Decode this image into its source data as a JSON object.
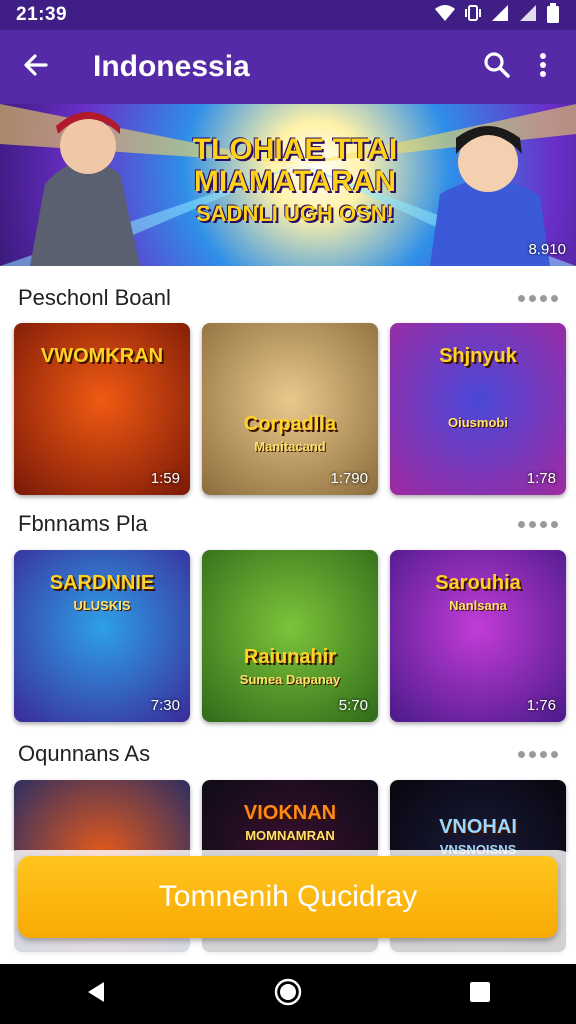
{
  "status_bar": {
    "time": "21:39"
  },
  "app_bar": {
    "title": "Indonessia"
  },
  "banner": {
    "line1": "TLOHIAE TTAI",
    "line2": "MIAMATARAN",
    "line3": "SADNLI UGH OSN!",
    "count": "8.910"
  },
  "sections": [
    {
      "title": "Peschonl Boanl",
      "cards": [
        {
          "title": "VWOMKRAN",
          "subtitle": "",
          "count": "1:59",
          "colors": [
            "#f05a12",
            "#7a1808"
          ]
        },
        {
          "title": "Corpadlla",
          "subtitle": "Manitacand",
          "count": "1:790",
          "colors": [
            "#e9c98c",
            "#8b6c3c"
          ]
        },
        {
          "title": "Shjnyuk",
          "subtitle": "Oiusmobi",
          "count": "1:78",
          "colors": [
            "#4a48d8",
            "#a02aa0"
          ]
        }
      ]
    },
    {
      "title": "Fbnnams Pla",
      "cards": [
        {
          "title": "SARDNNIE",
          "subtitle": "ULUSKIS",
          "count": "7:30",
          "colors": [
            "#2ea0e8",
            "#3a2a9a"
          ]
        },
        {
          "title": "Raiunahir",
          "subtitle": "Sumea Dapanay",
          "count": "5:70",
          "colors": [
            "#7cc43a",
            "#2f6a1a"
          ]
        },
        {
          "title": "Sarouhia",
          "subtitle": "Nanlsana",
          "count": "1:76",
          "colors": [
            "#c23cd8",
            "#4a1a8a"
          ]
        }
      ]
    },
    {
      "title": "Oqunnans As",
      "cards": [
        {
          "title": "",
          "subtitle": "",
          "count": "",
          "colors": [
            "#e85a1a",
            "#1a2a6a"
          ]
        },
        {
          "title": "VIOKNAN",
          "subtitle": "MOMNAMRAN",
          "count": "",
          "colors": [
            "#3a1030",
            "#0a0a14"
          ]
        },
        {
          "title": "VNOHAI",
          "subtitle": "VNSNOISNS",
          "count": "",
          "colors": [
            "#1a1a3a",
            "#05050a"
          ]
        }
      ]
    }
  ],
  "cta": {
    "label": "Tomnenih Qucidray"
  },
  "icons": {
    "back": "arrow-back-icon",
    "search": "search-icon",
    "menu": "more-vert-icon",
    "nav_back": "triangle-back-icon",
    "nav_home": "circle-home-icon",
    "nav_recents": "square-recents-icon"
  },
  "colors": {
    "status_bar": "#3f1f86",
    "app_bar": "#552aa6",
    "cta": "#f7b500",
    "nav_bar": "#000000"
  }
}
